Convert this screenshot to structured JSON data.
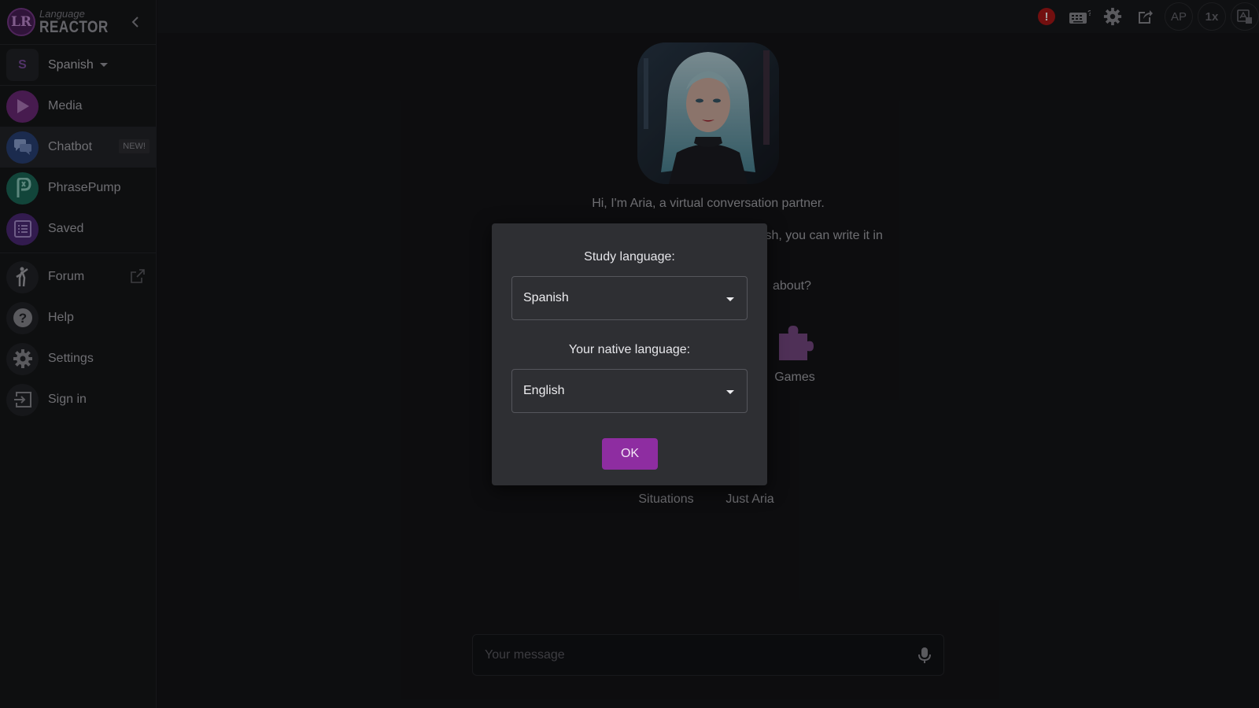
{
  "app": {
    "logo_small": "Language",
    "logo_big": "REACTOR",
    "logo_mark": "LR"
  },
  "sidebar": {
    "language_badge": "S",
    "language_label": "Spanish",
    "items": [
      {
        "label": "Media",
        "icon": "play-icon",
        "color": "#7a2f86"
      },
      {
        "label": "Chatbot",
        "icon": "chat-icon",
        "color": "#2f4a86",
        "badge": "NEW!"
      },
      {
        "label": "PhrasePump",
        "icon": "phrasepump-icon",
        "color": "#1f7a66"
      },
      {
        "label": "Saved",
        "icon": "list-icon",
        "color": "#5a2f86"
      },
      {
        "label": "Forum",
        "icon": "person-icon",
        "color": "#2a2b2f"
      },
      {
        "label": "Help",
        "icon": "help-icon",
        "color": "#2a2b2f"
      },
      {
        "label": "Settings",
        "icon": "gear-icon",
        "color": "#2a2b2f"
      },
      {
        "label": "Sign in",
        "icon": "sign-in-icon",
        "color": "#2a2b2f"
      }
    ]
  },
  "topbar": {
    "ap_label": "AP",
    "speed_label": "1x",
    "error_symbol": "!"
  },
  "main": {
    "intro_line1": "Hi, I'm Aria, a virtual conversation partner.",
    "partial_line2": "nish, you can write it in",
    "partial_line3": "about?",
    "categories": [
      "Games",
      "Situations",
      "Just Aria"
    ],
    "message_placeholder": "Your message"
  },
  "modal": {
    "study_label": "Study language:",
    "study_value": "Spanish",
    "native_label": "Your native language:",
    "native_value": "English",
    "ok_label": "OK"
  }
}
